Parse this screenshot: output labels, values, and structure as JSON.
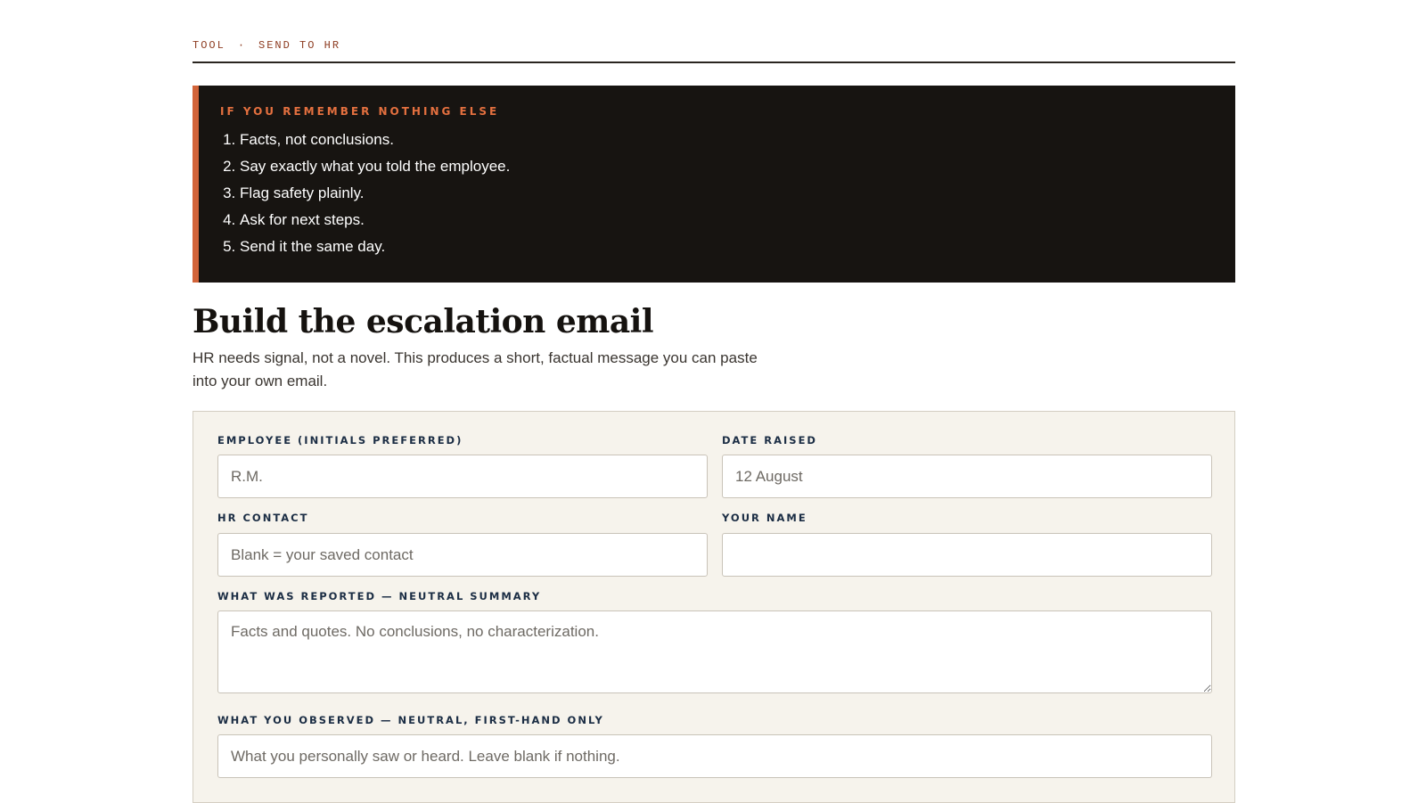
{
  "breadcrumb": {
    "section": "TOOL",
    "separator": "·",
    "page": "SEND TO HR"
  },
  "callout": {
    "heading": "IF YOU REMEMBER NOTHING ELSE",
    "items": [
      "Facts, not conclusions.",
      "Say exactly what you told the employee.",
      "Flag safety plainly.",
      "Ask for next steps.",
      "Send it the same day."
    ]
  },
  "header": {
    "title": "Build the escalation email",
    "lede": "HR needs signal, not a novel. This produces a short, factual message you can paste into your own email."
  },
  "form": {
    "employee": {
      "label": "EMPLOYEE (INITIALS PREFERRED)",
      "value": "",
      "placeholder": "R.M."
    },
    "date_raised": {
      "label": "DATE RAISED",
      "value": "",
      "placeholder": "12 August"
    },
    "hr_contact": {
      "label": "HR CONTACT",
      "value": "",
      "placeholder": "Blank = your saved contact"
    },
    "your_name": {
      "label": "YOUR NAME",
      "value": "",
      "placeholder": ""
    },
    "reported": {
      "label": "WHAT WAS REPORTED — NEUTRAL SUMMARY",
      "value": "",
      "placeholder": "Facts and quotes. No conclusions, no characterization."
    },
    "observed": {
      "label": "WHAT YOU OBSERVED — NEUTRAL, FIRST-HAND ONLY",
      "value": "",
      "placeholder": "What you personally saw or heard. Leave blank if nothing."
    }
  },
  "colors": {
    "accent": "#d2643a",
    "callout_bg": "#171411",
    "panel_bg": "#f6f3ec",
    "label_navy": "#1b2d44"
  }
}
